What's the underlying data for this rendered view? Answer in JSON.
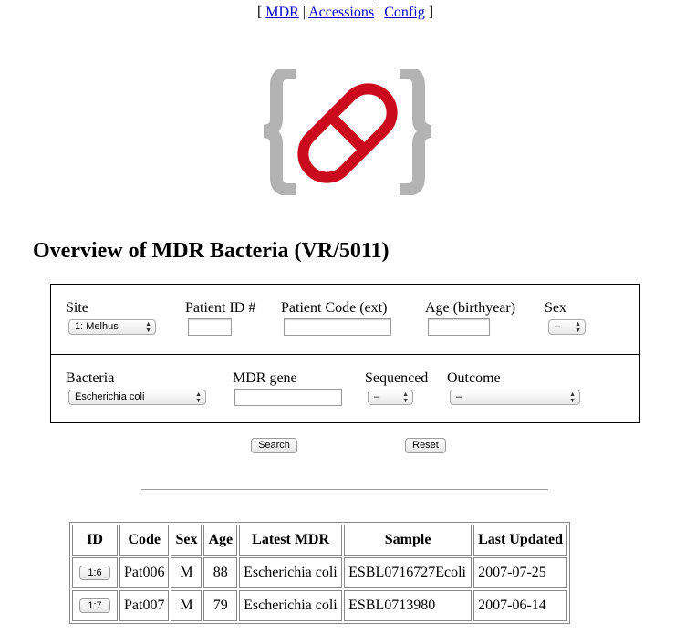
{
  "nav": {
    "open_bracket": "[",
    "close_bracket": "]",
    "separator": "|",
    "links": [
      "MDR",
      "Accessions",
      "Config"
    ]
  },
  "logo": {
    "icon": "pill-in-braces-logo",
    "brace_color": "#b3b3b3",
    "pill_color": "#cc0a1e"
  },
  "title": "Overview of MDR Bacteria (VR/5011)",
  "filters": {
    "site": {
      "label": "Site",
      "value": "1: Melhus"
    },
    "patient_id": {
      "label": "Patient ID #",
      "value": ""
    },
    "patient_code": {
      "label": "Patient Code (ext)",
      "value": ""
    },
    "age": {
      "label": "Age (birthyear)",
      "value": ""
    },
    "sex": {
      "label": "Sex",
      "value": "–"
    },
    "bacteria": {
      "label": "Bacteria",
      "value": "Escherichia coli"
    },
    "mdr_gene": {
      "label": "MDR gene",
      "value": ""
    },
    "sequenced": {
      "label": "Sequenced",
      "value": "–"
    },
    "outcome": {
      "label": "Outcome",
      "value": "–"
    }
  },
  "buttons": {
    "search": "Search",
    "reset": "Reset"
  },
  "table": {
    "headers": [
      "ID",
      "Code",
      "Sex",
      "Age",
      "Latest MDR",
      "Sample",
      "Last Updated"
    ],
    "rows": [
      {
        "id": "1:6",
        "code": "Pat006",
        "sex": "M",
        "age": "88",
        "latest_mdr": "Escherichia coli",
        "sample": "ESBL0716727Ecoli",
        "last_updated": "2007-07-25"
      },
      {
        "id": "1:7",
        "code": "Pat007",
        "sex": "M",
        "age": "79",
        "latest_mdr": "Escherichia coli",
        "sample": "ESBL0713980",
        "last_updated": "2007-06-14"
      }
    ]
  }
}
